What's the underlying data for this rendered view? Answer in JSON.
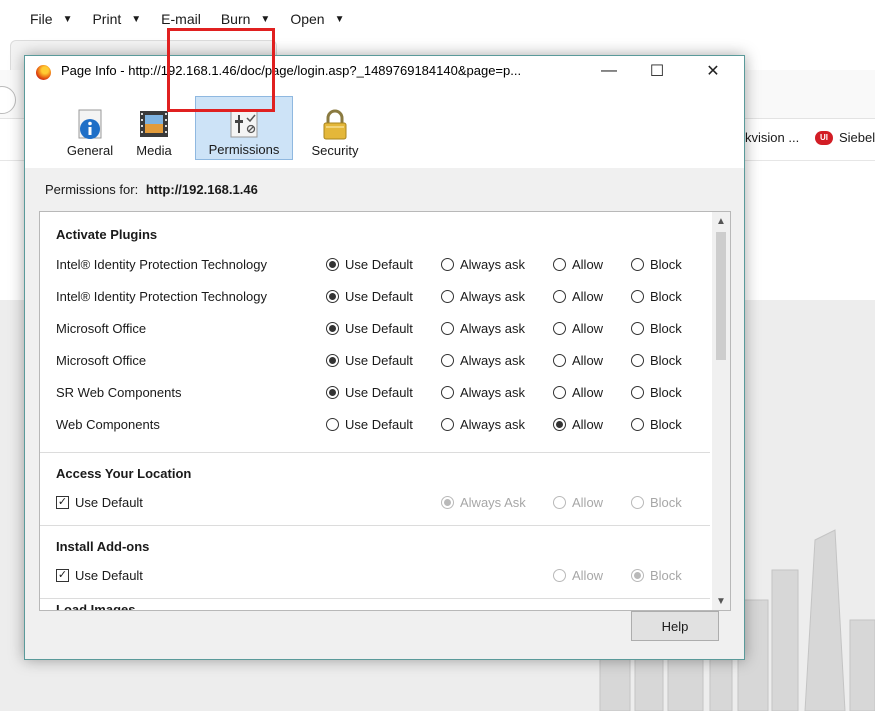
{
  "menubar": {
    "items": [
      {
        "label": "File",
        "caret": true
      },
      {
        "label": "Print",
        "caret": true
      },
      {
        "label": "E-mail",
        "caret": false
      },
      {
        "label": "Burn",
        "caret": true
      },
      {
        "label": "Open",
        "caret": true
      }
    ]
  },
  "bookmarks": {
    "item1": "kvision ...",
    "item2": "Siebel",
    "item2_icon_text": "UI"
  },
  "dialog": {
    "title": "Page Info - http://192.168.1.46/doc/page/login.asp?_1489769184140&page=p...",
    "buttons": {
      "minimize": "—",
      "maximize": "☐",
      "close": "✕"
    },
    "tabs": [
      {
        "label": "General",
        "icon": "info-page-icon",
        "selected": false
      },
      {
        "label": "Media",
        "icon": "media-film-icon",
        "selected": false
      },
      {
        "label": "Permissions",
        "icon": "permissions-sliders-icon",
        "selected": true
      },
      {
        "label": "Security",
        "icon": "padlock-icon",
        "selected": false
      }
    ],
    "permissions_for_label": "Permissions for:",
    "permissions_for_url": "http://192.168.1.46",
    "options": {
      "use_default": "Use Default",
      "always_ask": "Always ask",
      "allow": "Allow",
      "block": "Block",
      "always_ask_cap": "Always Ask"
    },
    "plugins": {
      "title": "Activate Plugins",
      "rows": [
        {
          "name": "Intel® Identity Protection Technology",
          "selected": "use_default"
        },
        {
          "name": "Intel® Identity Protection Technology",
          "selected": "use_default"
        },
        {
          "name": "Microsoft Office",
          "selected": "use_default"
        },
        {
          "name": "Microsoft Office",
          "selected": "use_default"
        },
        {
          "name": "SR Web Components",
          "selected": "use_default"
        },
        {
          "name": "Web Components",
          "selected": "allow"
        }
      ]
    },
    "location": {
      "title": "Access Your Location",
      "use_default_checked": true,
      "selected": "always_ask"
    },
    "addons": {
      "title": "Install Add-ons",
      "use_default_checked": true,
      "selected": "block"
    },
    "next_section_partial": "Load Images",
    "help_label": "Help"
  }
}
